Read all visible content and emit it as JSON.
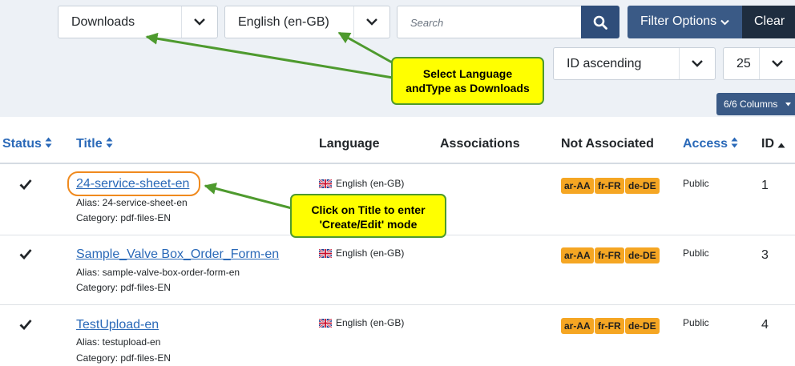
{
  "filters": {
    "type_select": "Downloads",
    "language_select": "English (en-GB)",
    "search_placeholder": "Search",
    "filter_options_label": "Filter Options",
    "clear_label": "Clear",
    "ordering_select": "ID ascending",
    "limit_select": "25",
    "columns_label": "6/6 Columns"
  },
  "callouts": {
    "language": [
      "Select Language",
      "andType as Downloads"
    ],
    "title": [
      "Click on Title to enter",
      "'Create/Edit' mode"
    ]
  },
  "table": {
    "headers": {
      "status": "Status",
      "title": "Title",
      "language": "Language",
      "associations": "Associations",
      "not_associated": "Not Associated",
      "access": "Access",
      "id": "ID"
    },
    "rows": [
      {
        "title": "24-service-sheet-en",
        "alias": "Alias: 24-service-sheet-en",
        "category": "Category: pdf-files-EN",
        "language": "English (en-GB)",
        "badges": [
          "ar-AA",
          "fr-FR",
          "de-DE"
        ],
        "access": "Public",
        "id": "1"
      },
      {
        "title": "Sample_Valve Box_Order_Form-en",
        "alias": "Alias: sample-valve-box-order-form-en",
        "category": "Category: pdf-files-EN",
        "language": "English (en-GB)",
        "badges": [
          "ar-AA",
          "fr-FR",
          "de-DE"
        ],
        "access": "Public",
        "id": "3"
      },
      {
        "title": "TestUpload-en",
        "alias": "Alias: testupload-en",
        "category": "Category: pdf-files-EN",
        "language": "English (en-GB)",
        "badges": [
          "ar-AA",
          "fr-FR",
          "de-DE"
        ],
        "access": "Public",
        "id": "4"
      }
    ]
  },
  "colors": {
    "toolbar_bg": "#edf1f6",
    "primary": "#3a5a86",
    "dark": "#1e2d3f",
    "link": "#2a69b8",
    "badge": "#f5a623",
    "callout": "#ffff00",
    "arrow": "#4e9a2e",
    "highlight_ring": "#f08a1e"
  },
  "icons": [
    "chevron-down-icon",
    "search-icon",
    "sort-icon",
    "sort-up-icon",
    "check-icon",
    "uk-flag-icon",
    "caret-down-icon"
  ]
}
